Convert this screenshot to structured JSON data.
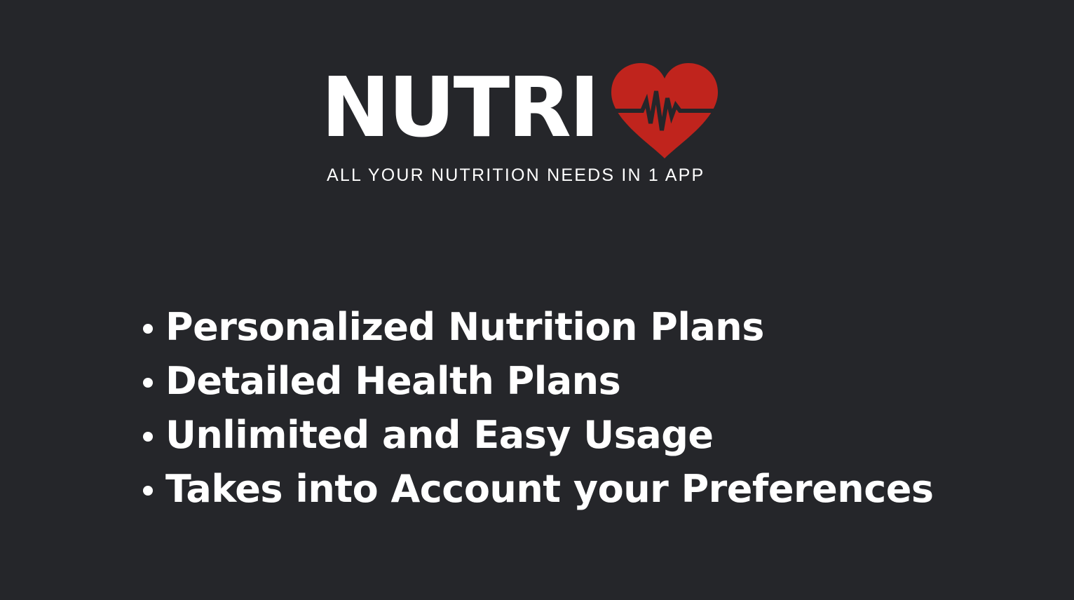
{
  "brand": {
    "name": "NUTRI",
    "tagline": "ALL YOUR NUTRITION NEEDS IN 1 APP",
    "logo_icon": "heart-pulse-icon",
    "logo_color": "#c0241d"
  },
  "features": [
    {
      "text": "Personalized Nutrition Plans"
    },
    {
      "text": "Detailed Health Plans"
    },
    {
      "text": "Unlimited and Easy Usage"
    },
    {
      "text": "Takes into Account your Preferences"
    }
  ],
  "colors": {
    "background": "#25262a",
    "text": "#ffffff",
    "accent": "#c0241d"
  }
}
